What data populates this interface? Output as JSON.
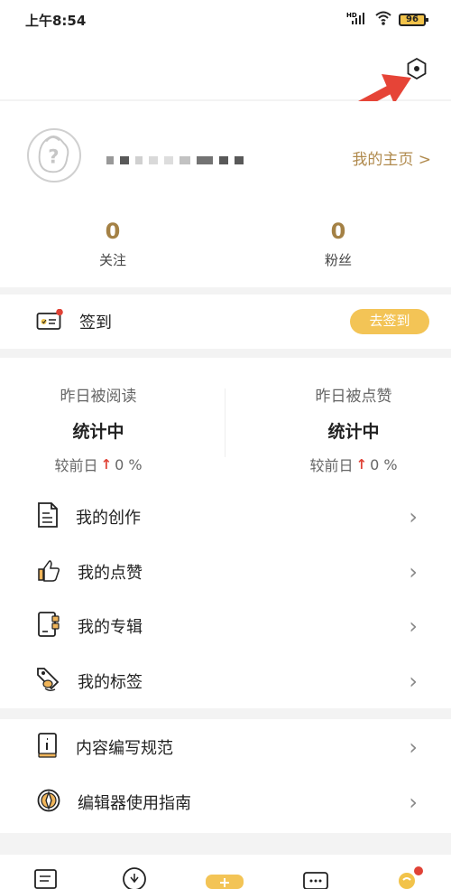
{
  "status_bar": {
    "time": "上午8:54",
    "signal": "HD",
    "battery": "96",
    "signal_icon": "signal-icon",
    "wifi_icon": "wifi-icon",
    "battery_icon": "battery-icon"
  },
  "header": {
    "settings_icon": "settings-icon"
  },
  "profile": {
    "homepage_link": "我的主页 >",
    "following": {
      "count": "0",
      "label": "关注"
    },
    "followers": {
      "count": "0",
      "label": "粉丝"
    }
  },
  "checkin": {
    "label": "签到",
    "button": "去签到",
    "icon": "checkin-icon"
  },
  "stats": {
    "read": {
      "title": "昨日被阅读",
      "value": "统计中",
      "compare": "较前日",
      "percent": "0 %"
    },
    "likes": {
      "title": "昨日被点赞",
      "value": "统计中",
      "compare": "较前日",
      "percent": "0 %"
    }
  },
  "menu": [
    {
      "label": "我的创作",
      "icon": "document-icon"
    },
    {
      "label": "我的点赞",
      "icon": "thumbs-up-icon"
    },
    {
      "label": "我的专辑",
      "icon": "album-icon"
    },
    {
      "label": "我的标签",
      "icon": "tag-icon"
    }
  ],
  "guides": [
    {
      "label": "内容编写规范",
      "icon": "info-book-icon"
    },
    {
      "label": "编辑器使用指南",
      "icon": "compass-icon"
    }
  ],
  "colors": {
    "accent": "#f3c456",
    "stat_brown": "#a48145",
    "link_brown": "#b08a4d",
    "arrow_red": "#e64437",
    "notification_red": "#e04236"
  }
}
